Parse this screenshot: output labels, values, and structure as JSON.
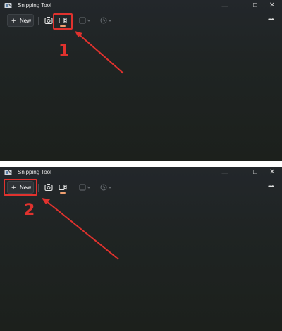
{
  "window": {
    "title": "Snipping Tool",
    "minimize_glyph": "—",
    "maximize_glyph": "☐",
    "close_glyph": "✕"
  },
  "toolbar": {
    "new_label": "New",
    "new_icon": "plus-icon",
    "snip_mode_icon": "camera-icon",
    "record_mode_icon": "video-icon",
    "shape_dropdown_icon": "rectangle-shape-icon",
    "delay_dropdown_icon": "clock-icon",
    "more_label": "•••"
  },
  "annotations": {
    "step_1": "1",
    "step_2": "2",
    "color": "#e0322e"
  },
  "colors": {
    "window_bg": "#1f2423",
    "record_underline": "#f0a070"
  }
}
